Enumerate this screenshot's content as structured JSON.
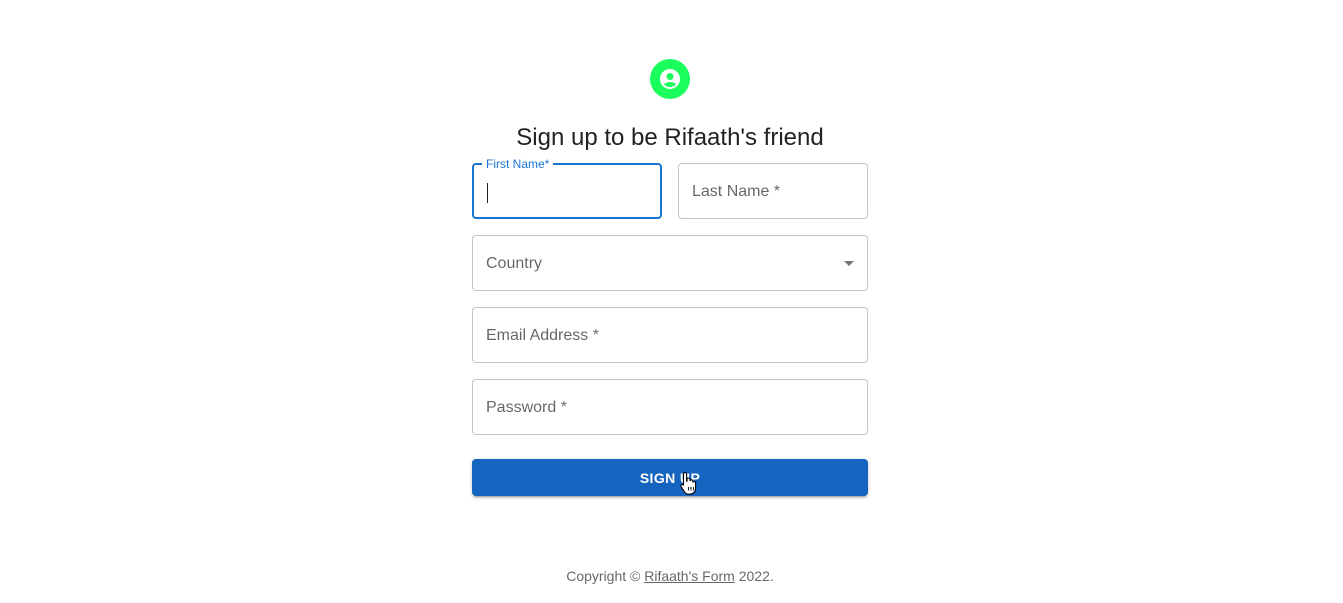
{
  "header": {
    "avatar_icon": "person-icon",
    "avatar_color": "#1aff5c",
    "title": "Sign up to be Rifaath's friend"
  },
  "form": {
    "first_name": {
      "label": "First Name",
      "required_mark": "*",
      "value": ""
    },
    "last_name": {
      "label": "Last Name",
      "required_mark": "*",
      "value": ""
    },
    "country": {
      "label": "Country",
      "value": ""
    },
    "email": {
      "label": "Email Address",
      "required_mark": "*",
      "value": ""
    },
    "password": {
      "label": "Password",
      "required_mark": "*",
      "value": ""
    },
    "submit_label": "SIGN UP"
  },
  "footer": {
    "prefix": "Copyright © ",
    "link_text": "Rifaath's Form",
    "suffix": " 2022."
  },
  "colors": {
    "primary": "#1565c0",
    "focus": "#1976d2",
    "avatar": "#1aff5c"
  }
}
